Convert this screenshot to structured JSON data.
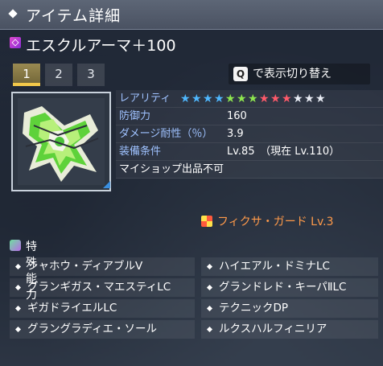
{
  "header": {
    "title": "アイテム詳細"
  },
  "item": {
    "name": "エスクルアーマ＋100"
  },
  "tabs": [
    "1",
    "2",
    "3"
  ],
  "toggle": {
    "key": "Q",
    "label": "で表示切り替え"
  },
  "stats": {
    "rarity_label": "レアリティ",
    "rarity_stars": 13,
    "star_colors": [
      "#4fb8ff",
      "#4fb8ff",
      "#4fb8ff",
      "#4fb8ff",
      "#8ee64f",
      "#8ee64f",
      "#8ee64f",
      "#ff5a6a",
      "#ff5a6a",
      "#ff5a6a",
      "#e9edf5",
      "#e9edf5",
      "#e9edf5"
    ],
    "defense_label": "防御力",
    "defense_value": "160",
    "dmg_resist_label": "ダメージ耐性（％）",
    "dmg_resist_value": "3.9",
    "requirement_label": "装備条件",
    "requirement_value": "Lv.85　（現在 Lv.110）",
    "shop_note": "マイショップ出品不可"
  },
  "fixa": {
    "label": "フィクサ・ガード Lv.3"
  },
  "special": {
    "header": "特殊能力",
    "abilities": [
      "シャホウ・ディアブルⅤ",
      "ハイエアル・ドミナLC",
      "グランギガス・マエスティLC",
      "グランドレド・キーパⅡLC",
      "ギガドライエルLC",
      "テクニックDP",
      "グラングラディエ・ソール",
      "ルクスハルフィニリア"
    ]
  }
}
